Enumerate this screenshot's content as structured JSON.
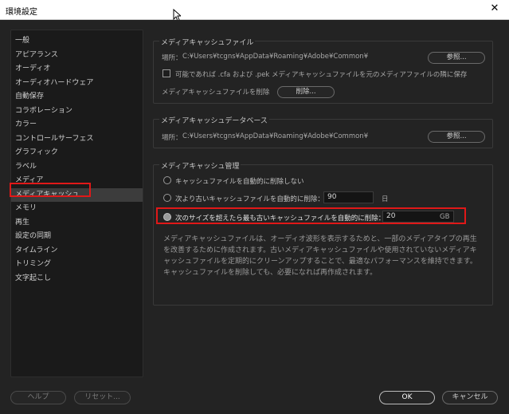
{
  "window": {
    "title": "環境設定",
    "close_glyph": "✕"
  },
  "sidebar": {
    "items": [
      {
        "label": "一般"
      },
      {
        "label": "アピアランス"
      },
      {
        "label": "オーディオ"
      },
      {
        "label": "オーディオハードウェア"
      },
      {
        "label": "自動保存"
      },
      {
        "label": "コラボレーション"
      },
      {
        "label": "カラー"
      },
      {
        "label": "コントロールサーフェス"
      },
      {
        "label": "グラフィック"
      },
      {
        "label": "ラベル"
      },
      {
        "label": "メディア"
      },
      {
        "label": "メディアキャッシュ"
      },
      {
        "label": "メモリ"
      },
      {
        "label": "再生"
      },
      {
        "label": "設定の同期"
      },
      {
        "label": "タイムライン"
      },
      {
        "label": "トリミング"
      },
      {
        "label": "文字起こし"
      }
    ],
    "selected_index": 11
  },
  "cache_files": {
    "title": "メディアキャッシュファイル",
    "location_label": "場所：",
    "location_path": "C:¥Users¥tcgns¥AppData¥Roaming¥Adobe¥Common¥",
    "browse_label": "参照...",
    "save_next_label": "可能であれば .cfa および .pek メディアキャッシュファイルを元のメディアファイルの隣に保存",
    "save_next_checked": false,
    "delete_label": "メディアキャッシュファイルを削除",
    "delete_button": "削除..."
  },
  "cache_db": {
    "title": "メディアキャッシュデータベース",
    "location_label": "場所：",
    "location_path": "C:¥Users¥tcgns¥AppData¥Roaming¥Adobe¥Common¥",
    "browse_label": "参照..."
  },
  "cache_mgmt": {
    "title": "メディアキャッシュ管理",
    "option_never": "キャッシュファイルを自動的に削除しない",
    "option_older": "次より古いキャッシュファイルを自動的に削除：",
    "older_value": "90",
    "older_unit": "日",
    "option_size": "次のサイズを超えたら最も古いキャッシュファイルを自動的に削除：",
    "size_value": "20",
    "size_unit": "GB",
    "selected_option": "size",
    "description": "メディアキャッシュファイルは、オーディオ波形を表示するためと、一部のメディアタイプの再生を改善するために作成されます。古いメディアキャッシュファイルや使用されていないメディアキャッシュファイルを定期的にクリーンアップすることで、最適なパフォーマンスを維持できます。キャッシュファイルを削除しても、必要になれば再作成されます。"
  },
  "footer": {
    "help": "ヘルプ",
    "reset": "リセット...",
    "ok": "OK",
    "cancel": "キャンセル"
  },
  "colors": {
    "highlight": "#e01818",
    "background": "#232323"
  }
}
